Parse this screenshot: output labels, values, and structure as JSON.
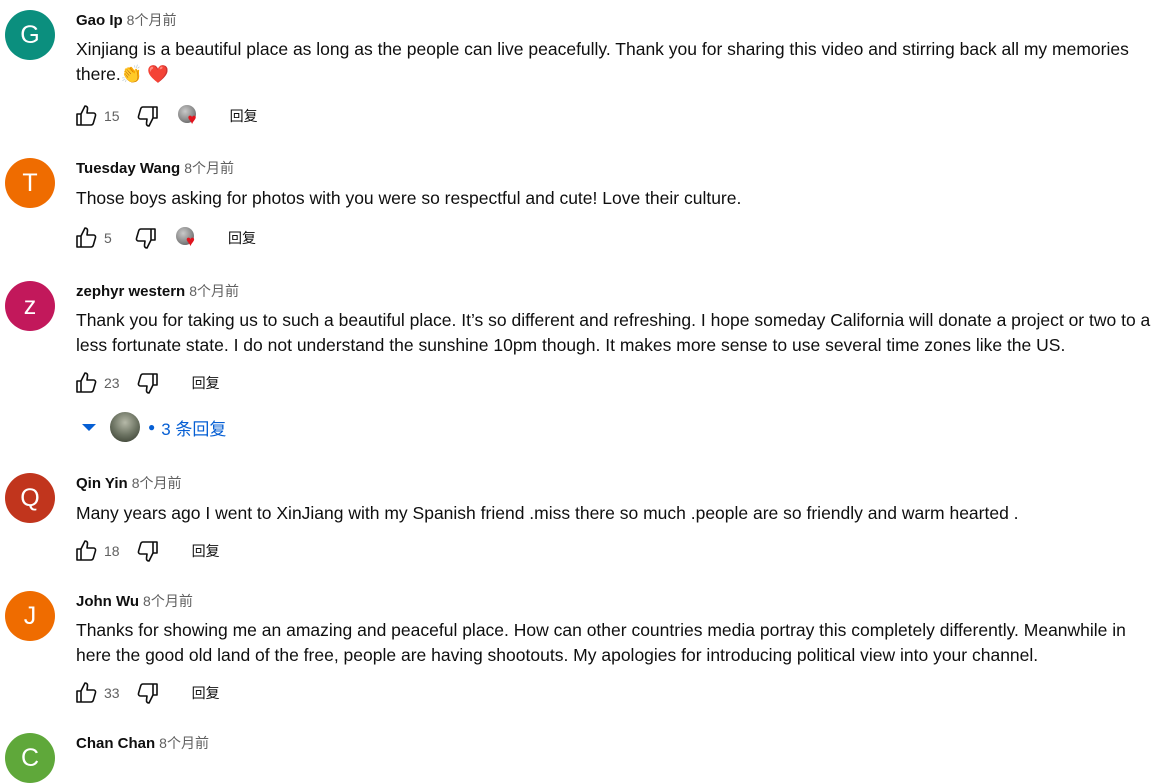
{
  "reply_label": "回复",
  "comments": [
    {
      "initial": "G",
      "avatar_color": "#0b8f7e",
      "author": "Gao Ip",
      "time": "8个月前",
      "text": "Xinjiang is a beautiful place as long as the people can live peacefully. Thank you for sharing this video and stirring back all my memories there.👏 ❤️",
      "likes": "15",
      "creator_heart": true
    },
    {
      "initial": "T",
      "avatar_color": "#ef6c00",
      "author": "Tuesday Wang",
      "time": "8个月前",
      "text": "Those boys asking for photos with you were so respectful and cute! Love their culture.",
      "likes": "5",
      "creator_heart": true
    },
    {
      "initial": "z",
      "avatar_color": "#c2185b",
      "author": "zephyr western",
      "time": "8个月前",
      "text": "Thank you for taking us to such a beautiful place. It’s so different and refreshing. I hope someday California will donate a project or two to a less fortunate state. I do not understand the sunshine 10pm though. It makes more sense to use several time zones like the US.",
      "likes": "23",
      "creator_heart": false,
      "replies_label": "3 条回复"
    },
    {
      "initial": "Q",
      "avatar_color": "#c1351d",
      "author": "Qin Yin",
      "time": "8个月前",
      "text": "Many years ago I went to XinJiang with my Spanish friend .miss there so much .people are so friendly and warm hearted .",
      "likes": "18",
      "creator_heart": false
    },
    {
      "initial": "J",
      "avatar_color": "#ef6c00",
      "author": "John Wu",
      "time": "8个月前",
      "text": "Thanks for showing me an amazing and peaceful place.  How can other countries media portray this completely differently.  Meanwhile in here the good old land of the free, people are having shootouts.  My apologies for introducing political view into your channel.",
      "likes": "33",
      "creator_heart": false
    },
    {
      "initial": "C",
      "avatar_color": "#5fa83a",
      "author": "Chan Chan",
      "time": "8个月前",
      "text": "",
      "likes": "",
      "creator_heart": false
    }
  ]
}
